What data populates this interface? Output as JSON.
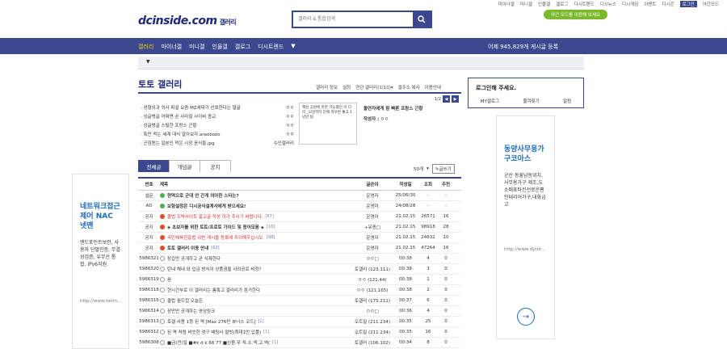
{
  "util_links": [
    "마이너갤",
    "미니갤",
    "인물갤",
    "갤로그",
    "디시트렌드",
    "디시뉴스",
    "디시게임",
    "이벤트",
    "디시콘",
    "로그인",
    "야간모드"
  ],
  "logo": {
    "text": "dcinside.com",
    "sub": "갤러리"
  },
  "search": {
    "placeholder": "갤러리 & 통합검색"
  },
  "darkmode_label": "야간 모드를 이용해 보세요",
  "nav": {
    "items": [
      "갤러리",
      "마이너갤",
      "미니갤",
      "인물갤",
      "갤로그",
      "디시트렌드"
    ],
    "count": "어제 945,829개 게시글 등록"
  },
  "page_title": "토토 갤러리",
  "page_menu": [
    "갤러리 정보",
    "설정",
    "연관 갤러리(1/10)▾",
    "갤주소 복사",
    "이용안내"
  ],
  "pager": {
    "text": "1/2"
  },
  "concepts": [
    {
      "title": "성형외과 의사 피셜 요즘 MZ세대가 선호한다는 얼굴",
      "src": "ㅇㅇ"
    },
    {
      "title": "싱글벙글 어쩌면 곧 사라질 사이비 종교",
      "src": "ㅇㅇ"
    },
    {
      "title": "싱글벙글 스릴한 프랑스 근황",
      "src": "ㅇㅇ"
    },
    {
      "title": "특만 먹는 세계 대식 알아보자.araobozo",
      "src": "ㅇㅇ"
    },
    {
      "title": "군침돋는 일본인 먹은 시장 음식들.jpg",
      "src": "수인갤러리"
    }
  ],
  "thumb_text": "제련 공원에 흔한 가능했던 이 다리 _모일부터 단에 적우면 좋고 1년만 됨",
  "featured": {
    "title": "돌연자에게 참 빠른 프랑스 근황",
    "author_label": "작성자 :",
    "author": "ㅇㅇ"
  },
  "login": {
    "title": "로그인해 주세요.",
    "links": [
      "MY갤로그",
      "즐겨찾기",
      "알림"
    ]
  },
  "ad_left": {
    "head": "네트워크접근제어 NAC 넷맨",
    "text": "엔드포인트보안, 사용자 단말인증, 무결성검증, 유무선 통합, IPv6지원.",
    "url": "http://www.netm..."
  },
  "ad_right": {
    "head": "동양사무용가구코아스",
    "text": "군산 동흥남동위치, 사무용가구 제조,도소매표타킨선로운팬 인테리어가구,내화금고",
    "url": "http://www.dytot..."
  },
  "tabs": [
    "전체글",
    "개념글",
    "공지"
  ],
  "tab_tools": {
    "count": "50개",
    "write": "글쓰기"
  },
  "table": {
    "headers": [
      "번호",
      "제목",
      "글쓴이",
      "작성일",
      "조회",
      "추천"
    ],
    "rows": [
      {
        "no": "설문",
        "icon": "green",
        "title": "현역으로 군대 안 간게 의아한 스타는?",
        "cm": "",
        "writer": "운영자",
        "date": "25/06/30",
        "view": "-",
        "rec": "-",
        "style": "bold"
      },
      {
        "no": "AD",
        "icon": "green",
        "title": "보험설정은 디시공식설계사에게 받으세요!",
        "cm": "",
        "writer": "운영자",
        "date": "24/08/28",
        "view": "-",
        "rec": "-",
        "style": "bold"
      },
      {
        "no": "공지",
        "icon": "red",
        "title": "불법 도박사이트 홍고글 작성 하가 주시기 바랍니다.",
        "cm": "[67]",
        "writer": "운영자",
        "date": "21.02.15",
        "view": "26571",
        "rec": "16",
        "style": "red"
      },
      {
        "no": "공지",
        "icon": "red",
        "title": "◈ 초보자를 위한 토토/프로토 가이드 및 용어모음 ◈",
        "cm": "[16]",
        "writer": "+유종□",
        "date": "21.02.15",
        "view": "98918",
        "rec": "28",
        "style": "bold"
      },
      {
        "no": "공지",
        "icon": "red",
        "title": "국민체육진흥법 위반 게시물 등록에 주의해주십시오.",
        "cm": "[98]",
        "writer": "운영자",
        "date": "21.02.15",
        "view": "24632",
        "rec": "10",
        "style": "red"
      },
      {
        "no": "공지",
        "icon": "red",
        "title": "토토 갤러리 이용 안내",
        "cm": "[62]",
        "writer": "운영자",
        "date": "21.02.15",
        "view": "47264",
        "rec": "16",
        "style": "bold"
      },
      {
        "no": "5986321",
        "icon": "gray",
        "title": "장갑만 공개하고 곧 삭제한다",
        "cm": "",
        "writer": "ㅇㅇ□",
        "date": "00:38",
        "view": "4",
        "rec": "0",
        "style": ""
      },
      {
        "no": "5986320",
        "icon": "gray",
        "title": "탄내 해내 와 입금 방식이 상품권을 사려공로 비정?",
        "cm": "",
        "writer": "토갤러 (123.111)",
        "date": "00:38",
        "view": "3",
        "rec": "0",
        "style": ""
      },
      {
        "no": "5986319",
        "icon": "gray",
        "title": "음",
        "cm": "",
        "writer": "ㅇㅇ (121.44)",
        "date": "00:38",
        "view": "1",
        "rec": "0",
        "style": ""
      },
      {
        "no": "5986318",
        "icon": "gray",
        "title": "현시간부로 이 갤러리는 톰톡고 갤러리가 점거한다",
        "cm": "",
        "writer": "ㅇㅇ (121.165)",
        "date": "00:38",
        "view": "2",
        "rec": "0",
        "style": ""
      },
      {
        "no": "5986316",
        "icon": "gray",
        "title": "클럽 월드컵 오늘은",
        "cm": "",
        "writer": "토갤러 (175.212)",
        "date": "00:37",
        "view": "6",
        "rec": "0",
        "style": ""
      },
      {
        "no": "5986314",
        "icon": "gray",
        "title": "장만만 공개하는 영상링크",
        "cm": "",
        "writer": "ㅇㅇ□",
        "date": "00:36",
        "view": "4",
        "rec": "0",
        "style": ""
      },
      {
        "no": "5986313",
        "icon": "gray",
        "title": "토갤 사용 1등 된 역 [Max 276만 뷰너스 코드]",
        "cm": "[1]",
        "writer": "오트밀 (211.234)",
        "date": "00:35",
        "view": "25",
        "rec": "0",
        "style": ""
      },
      {
        "no": "5986312",
        "icon": "gray",
        "title": "된 역 처럼 비슷한 영구 배팅사 멀빗(최대1만 입플)",
        "cm": "[1]",
        "writer": "오트밀 (211.234)",
        "date": "00:35",
        "view": "16",
        "rec": "0",
        "style": ""
      },
      {
        "no": "5986308",
        "icon": "gray",
        "title": "■금(전)일 ■#k d k 66 77 ■신용.무.적.소.액.고.액(",
        "cm": "[1]",
        "writer": "토갤러 (106.102)",
        "date": "00:34",
        "view": "8",
        "rec": "0",
        "style": ""
      }
    ]
  }
}
